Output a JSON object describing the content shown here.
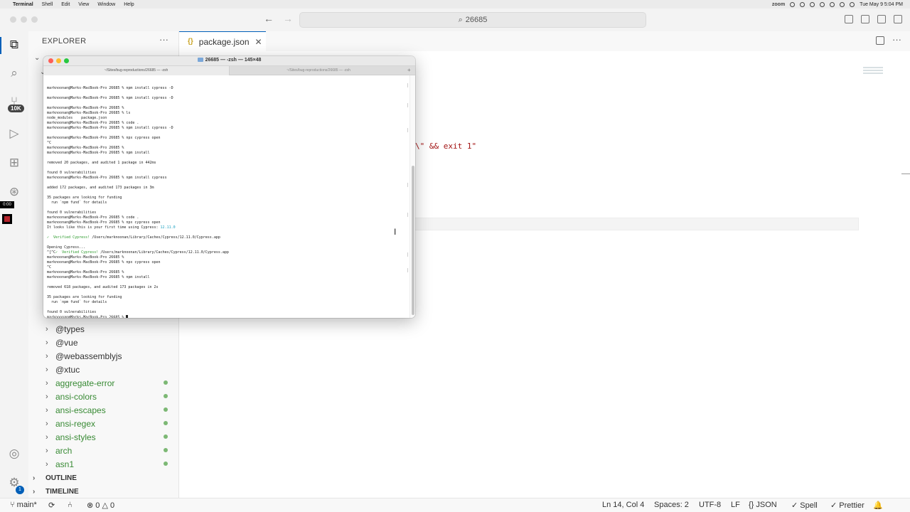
{
  "menubar": {
    "app": "Terminal",
    "menus": [
      "Shell",
      "Edit",
      "View",
      "Window",
      "Help"
    ],
    "zoom": "zoom",
    "datetime": "Tue May 9  5:04 PM"
  },
  "titlebar": {
    "search_text": "26685"
  },
  "activity_bar": {
    "badge": "10K",
    "timer": "0:00",
    "account_badge": "1"
  },
  "sidebar": {
    "title": "EXPLORER",
    "items": [
      {
        "label": "@types",
        "modified": false
      },
      {
        "label": "@vue",
        "modified": false
      },
      {
        "label": "@webassemblyjs",
        "modified": false
      },
      {
        "label": "@xtuc",
        "modified": false
      },
      {
        "label": "aggregate-error",
        "modified": true
      },
      {
        "label": "ansi-colors",
        "modified": true
      },
      {
        "label": "ansi-escapes",
        "modified": true
      },
      {
        "label": "ansi-regex",
        "modified": true
      },
      {
        "label": "ansi-styles",
        "modified": true
      },
      {
        "label": "arch",
        "modified": true
      },
      {
        "label": "asn1",
        "modified": true
      }
    ],
    "sections": [
      "OUTLINE",
      "TIMELINE"
    ]
  },
  "editor": {
    "tab_label": "package.json",
    "code_fragment_a": "\\\"",
    "code_fragment_b": " && exit 1\""
  },
  "terminal": {
    "title": "26685 — -zsh — 145×48",
    "tabs": [
      "~/Sites/bug-reproductions/26685 — -zsh",
      "~/Sites/bug-reproductions/26685 — -zsh"
    ],
    "lines": [
      "",
      "marknoonan@Marks-MacBook-Pro 26685 % npm install cypress -D",
      "",
      "marknoonan@Marks-MacBook-Pro 26685 % npm install cypress -D",
      "",
      "marknoonan@Marks-MacBook-Pro 26685 %",
      "marknoonan@Marks-MacBook-Pro 26685 % ls",
      "node_modules    package.json",
      "marknoonan@Marks-MacBook-Pro 26685 % code .",
      "marknoonan@Marks-MacBook-Pro 26685 % npm install cypress -D",
      "",
      "marknoonan@Marks-MacBook-Pro 26685 % npx cypress open",
      "^C",
      "marknoonan@Marks-MacBook-Pro 26685 %",
      "marknoonan@Marks-MacBook-Pro 26685 % npm install",
      "",
      "removed 20 packages, and audited 1 package in 442ms",
      "",
      "found 0 vulnerabilities",
      "marknoonan@Marks-MacBook-Pro 26685 % npm install cypress",
      "",
      "added 172 packages, and audited 173 packages in 3m",
      "",
      "35 packages are looking for funding",
      "  run `npm fund` for details",
      "",
      "found 0 vulnerabilities",
      "marknoonan@Marks-MacBook-Pro 26685 % code .",
      "marknoonan@Marks-MacBook-Pro 26685 % npx cypress open",
      "It looks like this is your first time using Cypress: ",
      "",
      "✓  Verified Cypress! /Users/marknoonan/Library/Caches/Cypress/12.11.0/Cypress.app",
      "",
      "Opening Cypress...",
      "^[^C✓  Verified Cypress! /Users/marknoonan/Library/Caches/Cypress/12.11.0/Cypress.app",
      "marknoonan@Marks-MacBook-Pro 26685 %",
      "marknoonan@Marks-MacBook-Pro 26685 % npx cypress open",
      "^C",
      "marknoonan@Marks-MacBook-Pro 26685 %",
      "marknoonan@Marks-MacBook-Pro 26685 % npm install",
      "",
      "removed 618 packages, and audited 173 packages in 2s",
      "",
      "35 packages are looking for funding",
      "  run `npm fund` for details",
      "",
      "found 0 vulnerabilities",
      "marknoonan@Marks-MacBook-Pro 26685 % "
    ],
    "cypress_version": "12.11.0",
    "verified_label": "✓  Verified Cypress!",
    "verified_path": " /Users/marknoonan/Library/Caches/Cypress/12.11.0/Cypress.app",
    "ctrl_prefix": "^[^C"
  },
  "statusbar": {
    "branch": "main*",
    "errors": "0",
    "warnings": "0",
    "position": "Ln 14, Col 4",
    "spaces": "Spaces: 2",
    "encoding": "UTF-8",
    "eol": "LF",
    "language": "JSON",
    "spell": "Spell",
    "prettier": "Prettier"
  },
  "colors": {
    "accent": "#005fb8",
    "git_modified": "#388a34",
    "terminal_green": "#2a9a2a",
    "terminal_cyan": "#1aa0c0"
  }
}
